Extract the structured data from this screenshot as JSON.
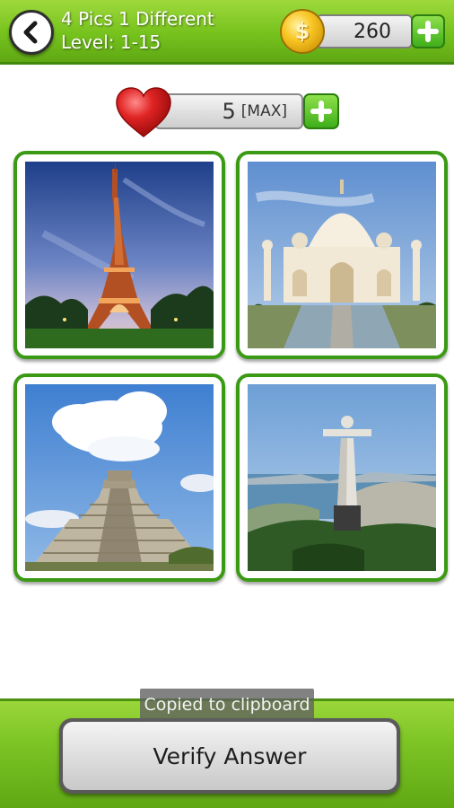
{
  "header": {
    "title": "4 Pics 1 Different",
    "level": "Level: 1-15",
    "coins": "260",
    "coin_symbol": "$"
  },
  "lives": {
    "count": "5",
    "max_label": "[MAX]"
  },
  "pictures": [
    {
      "name": "eiffel-tower"
    },
    {
      "name": "taj-mahal"
    },
    {
      "name": "chichen-itza-pyramid"
    },
    {
      "name": "christ-the-redeemer"
    }
  ],
  "toast": "Copied to clipboard",
  "verify_label": "Verify Answer",
  "colors": {
    "header_green": "#76c21d",
    "tile_border": "#3b9a14",
    "plus_green": "#3fae1b",
    "coin_gold": "#f8c623",
    "heart_red": "#d81e1e"
  }
}
